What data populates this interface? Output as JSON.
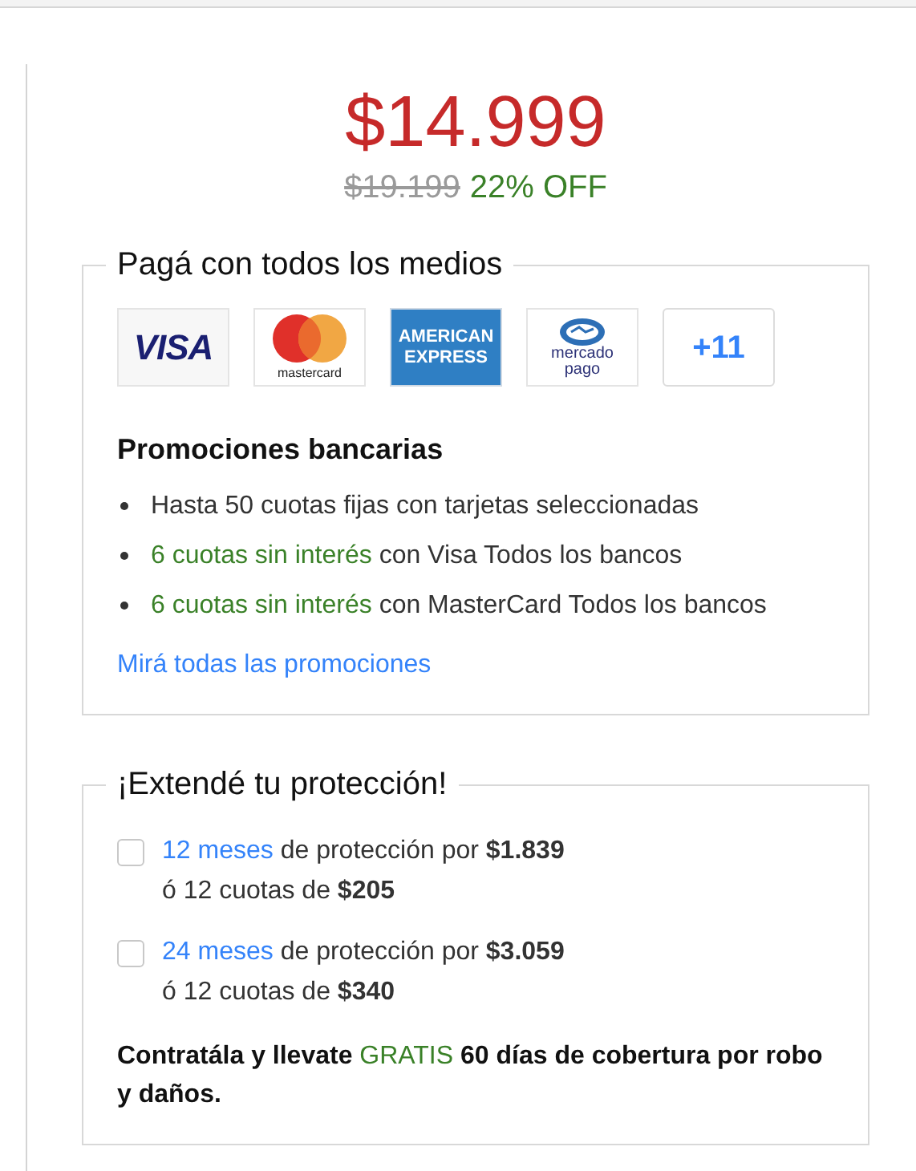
{
  "price": {
    "current": "$14.999",
    "original": "$19.199",
    "discount": "22% OFF"
  },
  "payments": {
    "title": "Pagá con todos los medios",
    "methods": [
      {
        "kind": "visa",
        "label": "VISA"
      },
      {
        "kind": "mastercard",
        "label": "mastercard"
      },
      {
        "kind": "amex",
        "label": "AMERICAN EXPRESS"
      },
      {
        "kind": "mercadopago",
        "label": "mercado pago"
      },
      {
        "kind": "more",
        "label": "+11"
      }
    ],
    "promotions_title": "Promociones bancarias",
    "promotions": [
      {
        "text": "Hasta 50 cuotas fijas con tarjetas seleccionadas"
      },
      {
        "highlight": "6 cuotas sin interés",
        "text": "con Visa Todos los bancos"
      },
      {
        "highlight": "6 cuotas sin interés",
        "text": "con MasterCard Todos los bancos"
      }
    ],
    "link": "Mirá todas las promociones"
  },
  "protection": {
    "title": "¡Extendé tu protección!",
    "options": [
      {
        "checked": false,
        "term": "12 meses",
        "text": "de protección por **$1.839**",
        "installments": "ó 12 cuotas de **$205**"
      },
      {
        "checked": false,
        "term": "24 meses",
        "text": "de protección por **$3.059**",
        "installments": "ó 12 cuotas de **$340**"
      }
    ],
    "note": {
      "before": "Contratála y llevate",
      "highlight": "GRATIS",
      "after": "60 días de cobertura por robo y daños."
    }
  }
}
